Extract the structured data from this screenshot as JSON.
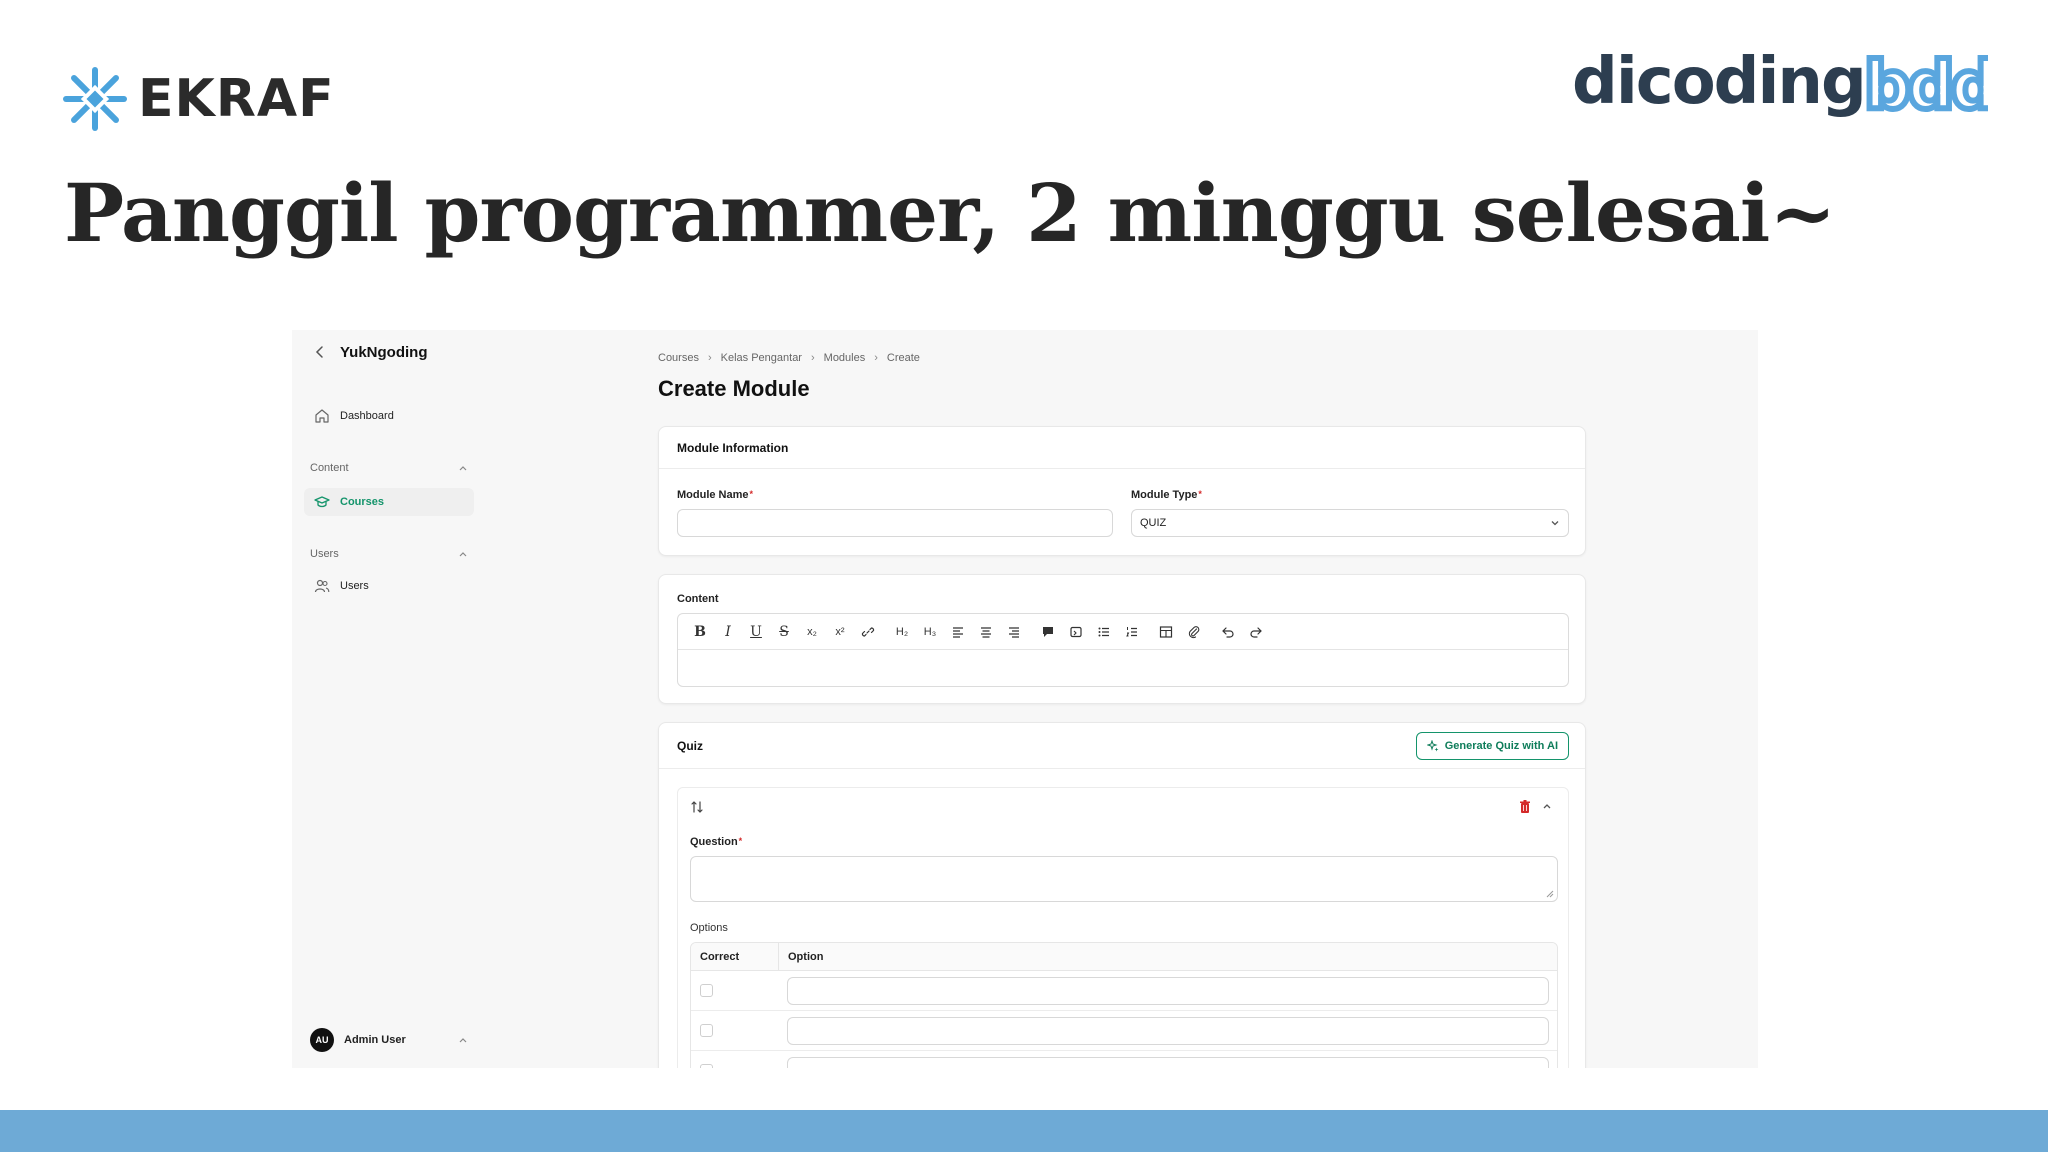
{
  "slide": {
    "brand_left": "EKRAF",
    "brand_right_1": "dicoding",
    "brand_right_2": "bdd",
    "headline": "Panggil programmer, 2 minggu selesai~",
    "colors": {
      "ekraf_blue": "#4aa3dc",
      "bar_blue": "#6eaad6",
      "dicoding_navy": "#2d3e50",
      "bdd_blue": "#5aa6de"
    }
  },
  "app": {
    "sidebar": {
      "title": "YukNgoding",
      "dashboard": "Dashboard",
      "group_content": "Content",
      "courses": "Courses",
      "group_users": "Users",
      "users": "Users",
      "user_initials": "AU",
      "user_name": "Admin User"
    },
    "breadcrumb": [
      "Courses",
      "Kelas Pengantar",
      "Modules",
      "Create"
    ],
    "page_title": "Create Module",
    "module_info": {
      "title": "Module Information",
      "name_label": "Module Name",
      "name_value": "",
      "type_label": "Module Type",
      "type_value": "QUIZ",
      "required_mark": "*"
    },
    "content": {
      "label": "Content",
      "toolbar": [
        "bold-icon",
        "italic-icon",
        "underline-icon",
        "strike-icon",
        "subscript-icon",
        "superscript-icon",
        "link-icon",
        "h2-icon",
        "h3-icon",
        "align-left-icon",
        "align-center-icon",
        "align-right-icon",
        "blockquote-icon",
        "code-icon",
        "bullet-list-icon",
        "ordered-list-icon",
        "table-icon",
        "attach-icon",
        "undo-icon",
        "redo-icon"
      ],
      "h2": "H₂",
      "h3": "H₃",
      "sub": "x₂",
      "sup": "x²"
    },
    "quiz": {
      "title": "Quiz",
      "generate_button": "Generate Quiz with AI",
      "question_label": "Question",
      "options_label": "Options",
      "col_correct": "Correct",
      "col_option": "Option",
      "accent": "#14946b",
      "danger": "#d42a2a"
    }
  }
}
